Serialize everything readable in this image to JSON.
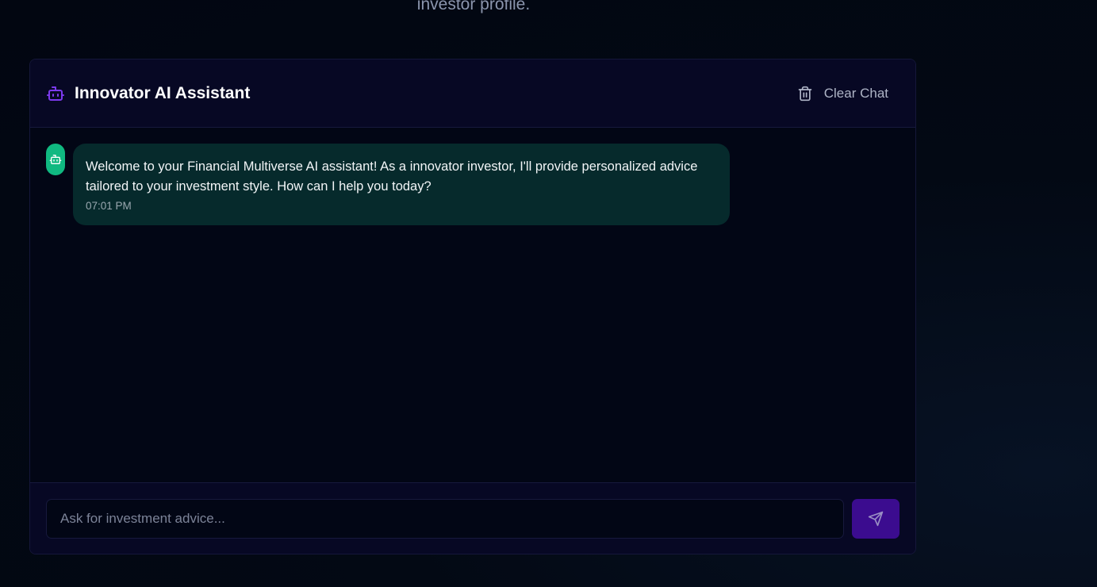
{
  "page": {
    "profile_text": "investor profile."
  },
  "chat": {
    "title": "Innovator AI Assistant",
    "clear_label": "Clear Chat",
    "input_placeholder": "Ask for investment advice...",
    "input_value": "",
    "messages": [
      {
        "sender": "assistant",
        "text": "Welcome to your Financial Multiverse AI assistant! As a innovator investor, I'll provide personalized advice tailored to your investment style. How can I help you today?",
        "time": "07:01 PM"
      }
    ]
  },
  "icons": {
    "header": "bot-icon",
    "avatar": "bot-icon",
    "clear": "trash-icon",
    "send": "send-icon"
  },
  "colors": {
    "accent": "#3b0c8f",
    "bot_icon": "#7c3aed",
    "avatar_bg": "#10b981",
    "bubble_bg": "#062a2c"
  }
}
